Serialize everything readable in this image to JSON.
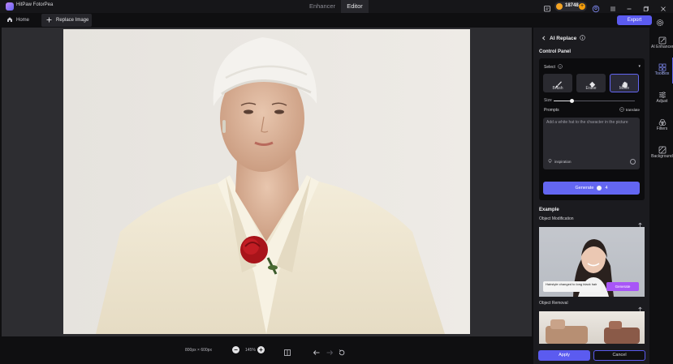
{
  "app": {
    "name": "HitPaw FotorPea"
  },
  "top_tabs": [
    {
      "label": "Enhancer",
      "active": false
    },
    {
      "label": "Editor",
      "active": true
    }
  ],
  "credits": {
    "value": "18748"
  },
  "subbar": {
    "home_label": "Home",
    "replace_tab_label": "Replace Image",
    "export_label": "Export"
  },
  "canvas": {
    "dimensions": "800px × 600px",
    "zoom": "145%"
  },
  "panel": {
    "title": "AI Replace",
    "control_panel_label": "Control Panel",
    "select_label": "Select",
    "tools": [
      {
        "label": "Brush",
        "active": false
      },
      {
        "label": "Erase",
        "active": false
      },
      {
        "label": "Move",
        "active": true
      }
    ],
    "size_label": "Size",
    "size_value": 0.22,
    "prompts_label": "Prompts",
    "translate_label": "translate",
    "prompt_placeholder": "Add a white hat to the character in the picture",
    "inspiration_label": "inspiration",
    "generate_label": "Generate",
    "generate_cost": "4",
    "example_title": "Example",
    "examples": [
      {
        "label": "Object Modification",
        "caption": "Hairstyle changed to long black hair",
        "button": "Generate"
      },
      {
        "label": "Object Removal"
      }
    ],
    "apply_label": "Apply",
    "cancel_label": "Cancel"
  },
  "rail": [
    {
      "label": "AI Enhancer",
      "icon": "ai-enhance-icon",
      "active": false
    },
    {
      "label": "ToolBox",
      "icon": "toolbox-icon",
      "active": true
    },
    {
      "label": "Adjust",
      "icon": "adjust-icon",
      "active": false
    },
    {
      "label": "Filters",
      "icon": "filters-icon",
      "active": false
    },
    {
      "label": "Background",
      "icon": "background-icon",
      "active": false
    }
  ],
  "colors": {
    "accent": "#6366f1",
    "coin": "#f5a524"
  }
}
